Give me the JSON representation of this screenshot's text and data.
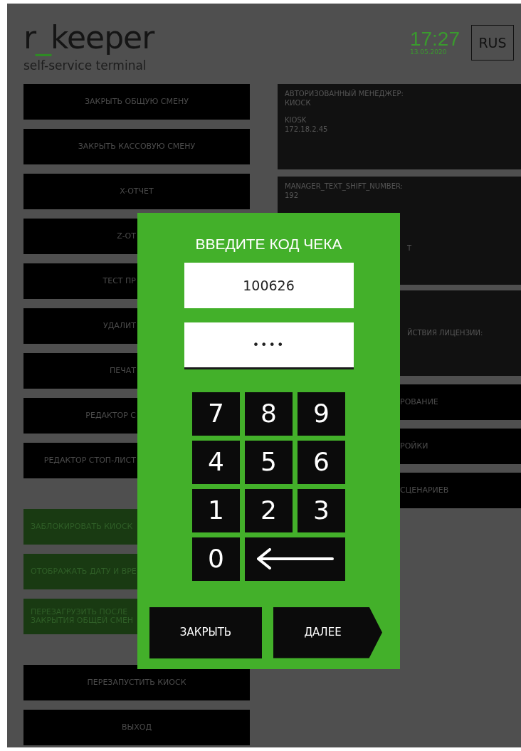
{
  "header": {
    "logo": [
      {
        "text": "r",
        "accent": false
      },
      {
        "text": "_",
        "accent": true
      },
      {
        "text": "keeper",
        "accent": false
      }
    ],
    "subtitle": "self-service terminal",
    "time": "17:27",
    "date": "13.05.2020",
    "language": "RUS"
  },
  "left_buttons": [
    {
      "label": "ЗАКРЫТЬ ОБЩУЮ СМЕНУ",
      "kind": "menu",
      "covered": false
    },
    {
      "label": "ЗАКРЫТЬ КАССОВУЮ СМЕНУ",
      "kind": "menu",
      "covered": false
    },
    {
      "label": "X-ОТЧЕТ",
      "kind": "menu",
      "covered": false
    },
    {
      "label": "Z-ОТ",
      "kind": "menu",
      "covered": true
    },
    {
      "label": "ТЕСТ ПР",
      "kind": "menu",
      "covered": true
    },
    {
      "label": "УДАЛИТ",
      "kind": "menu",
      "covered": true
    },
    {
      "label": "ПЕЧАТ",
      "kind": "menu",
      "covered": true
    },
    {
      "label": "РЕДАКТОР С",
      "kind": "menu",
      "covered": true
    },
    {
      "label": "РЕДАКТОР СТОП-ЛИСТ",
      "kind": "menu",
      "covered": true
    },
    {
      "label": "ЗАБЛОКИРОВАТЬ КИОСК",
      "kind": "toggle",
      "covered": true
    },
    {
      "label": "ОТОБРАЖАТЬ ДАТУ И ВРЕ",
      "kind": "toggle",
      "covered": true
    },
    {
      "label": "ПЕРЕЗАГРУЗИТЬ ПОСЛЕ\nЗАКРЫТИЯ ОБЩЕЙ СМЕН",
      "kind": "toggle",
      "covered": true
    },
    {
      "label": "ПЕРЕЗАПУСТИТЬ КИОСК",
      "kind": "menu",
      "covered": false
    },
    {
      "label": "ВЫХОД",
      "kind": "menu",
      "covered": false
    }
  ],
  "info_panels": [
    {
      "blocks": [
        [
          "АВТОРИЗОВАННЫЙ МЕНЕДЖЕР:",
          "КИОСК"
        ],
        [
          "KIOSK",
          "172.18.2.45"
        ]
      ]
    },
    {
      "blocks": [
        [
          "MANAGER_TEXT_SHIFT_NUMBER:",
          "192"
        ]
      ],
      "visible_part": "Т"
    },
    {
      "visible_part": "ЙСТВИЯ ЛИЦЕНЗИИ:"
    }
  ],
  "right_buttons": [
    "РОВАНИЕ",
    "РОЙКИ",
    "СЦЕНАРИЕВ"
  ],
  "dialog": {
    "title": "ВВЕДИТЕ КОД ЧЕКА",
    "code_field": {
      "value": "100626"
    },
    "pin_field": {
      "value": "••••"
    },
    "keys": [
      {
        "kind": "digit",
        "label": "7"
      },
      {
        "kind": "digit",
        "label": "8"
      },
      {
        "kind": "digit",
        "label": "9"
      },
      {
        "kind": "digit",
        "label": "4"
      },
      {
        "kind": "digit",
        "label": "5"
      },
      {
        "kind": "digit",
        "label": "6"
      },
      {
        "kind": "digit",
        "label": "1"
      },
      {
        "kind": "digit",
        "label": "2"
      },
      {
        "kind": "digit",
        "label": "3"
      },
      {
        "kind": "digit",
        "label": "0"
      },
      {
        "kind": "backspace"
      }
    ],
    "buttons": [
      {
        "label": "ЗАКРЫТЬ",
        "kind": "plain"
      },
      {
        "label": "ДАЛЕЕ",
        "kind": "arrow"
      }
    ]
  }
}
